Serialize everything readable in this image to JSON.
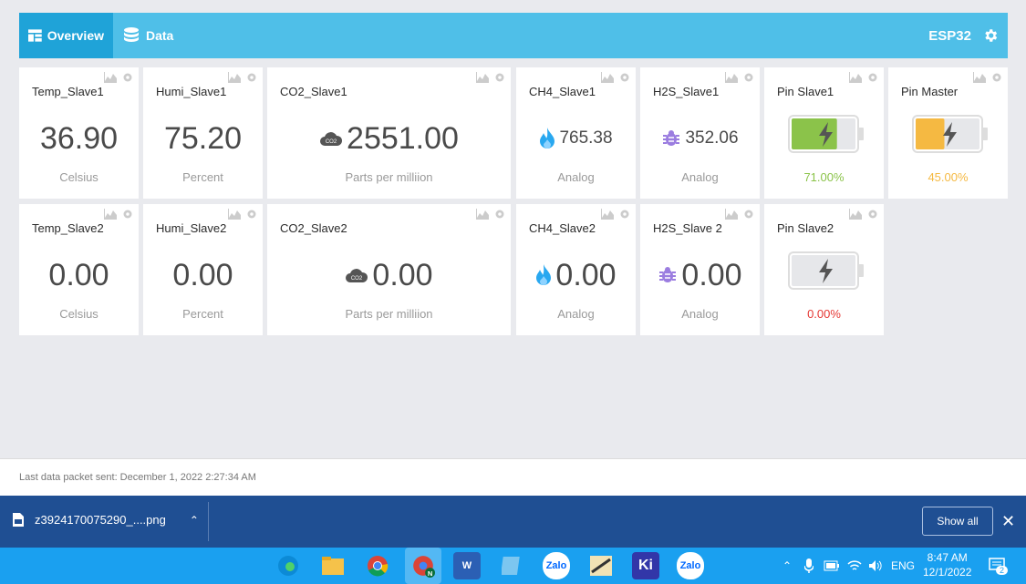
{
  "header": {
    "tabs": [
      {
        "label": "Overview",
        "icon": "dashboard-icon"
      },
      {
        "label": "Data",
        "icon": "database-icon"
      }
    ],
    "device_name": "ESP32"
  },
  "cards": {
    "temp1": {
      "title": "Temp_Slave1",
      "value": "36.90",
      "unit": "Celsius"
    },
    "humi1": {
      "title": "Humi_Slave1",
      "value": "75.20",
      "unit": "Percent"
    },
    "co21": {
      "title": "CO2_Slave1",
      "value": "2551.00",
      "unit": "Parts per milliion",
      "icon": "co2-cloud-icon"
    },
    "ch41": {
      "title": "CH4_Slave1",
      "value": "765.38",
      "unit": "Analog",
      "icon": "flame-icon"
    },
    "h2s1": {
      "title": "H2S_Slave1",
      "value": "352.06",
      "unit": "Analog",
      "icon": "bug-icon"
    },
    "pin1": {
      "title": "Pin Slave1",
      "percent": "71.00%",
      "level": 0.71,
      "color": "#8bc34a"
    },
    "pinm": {
      "title": "Pin Master",
      "percent": "45.00%",
      "level": 0.45,
      "color": "#f5b942"
    },
    "temp2": {
      "title": "Temp_Slave2",
      "value": "0.00",
      "unit": "Celsius"
    },
    "humi2": {
      "title": "Humi_Slave2",
      "value": "0.00",
      "unit": "Percent"
    },
    "co22": {
      "title": "CO2_Slave2",
      "value": "0.00",
      "unit": "Parts per milliion",
      "icon": "co2-cloud-icon"
    },
    "ch42": {
      "title": "CH4_Slave2",
      "value": "0.00",
      "unit": "Analog",
      "icon": "flame-icon"
    },
    "h2s2": {
      "title": "H2S_Slave 2",
      "value": "0.00",
      "unit": "Analog",
      "icon": "bug-icon"
    },
    "pin2": {
      "title": "Pin Slave2",
      "percent": "0.00%",
      "level": 0.0,
      "color": "#e53935"
    }
  },
  "footer": {
    "last_packet": "Last data packet sent: December 1, 2022 2:27:34 AM"
  },
  "download_bar": {
    "filename": "z3924170075290_....png",
    "show_all": "Show all"
  },
  "taskbar": {
    "apps": [
      "edge",
      "file-explorer",
      "chrome",
      "chrome-profile-n",
      "word",
      "notepad",
      "zalo",
      "app",
      "kicad",
      "zalo-call"
    ],
    "language": "ENG",
    "time": "8:47 AM",
    "date": "12/1/2022",
    "notifications": "2"
  },
  "colors": {
    "accent": "#4fbfe8",
    "accent_dark": "#1fa3d8",
    "download_bar": "#1f4f93",
    "taskbar": "#1aa0f0"
  }
}
